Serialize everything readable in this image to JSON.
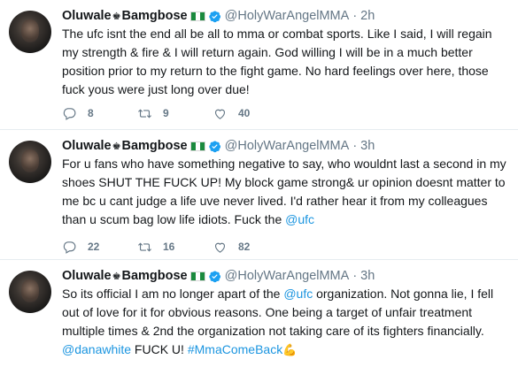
{
  "tweets": [
    {
      "name": "Oluwale",
      "crown": "♚",
      "name2": "Bamgbose",
      "handle": "@HolyWarAngelMMA",
      "separator": "·",
      "time": "2h",
      "text": "The ufc isnt the end all be all to mma or combat sports. Like I said, I will regain my strength & fire & I will return again. God willing I will be in a much better position prior to my return to the fight game. No hard feelings over here, those fuck yous were just long over due!",
      "replies": "8",
      "retweets": "9",
      "likes": "40"
    },
    {
      "name": "Oluwale",
      "crown": "♚",
      "name2": "Bamgbose",
      "handle": "@HolyWarAngelMMA",
      "separator": "·",
      "time": "3h",
      "text_main": "For u fans who have something negative to say, who wouldnt last a second in my shoes SHUT THE FUCK UP! My block game strong& ur opinion doesnt matter to me bc u cant judge a life uve never lived. I'd rather hear it from my colleagues than u scum bag low life idiots. Fuck the ",
      "mention": "@ufc",
      "replies": "22",
      "retweets": "16",
      "likes": "82"
    },
    {
      "name": "Oluwale",
      "crown": "♚",
      "name2": "Bamgbose",
      "handle": "@HolyWarAngelMMA",
      "separator": "·",
      "time": "3h",
      "text_a": "So its official I am no longer apart of the ",
      "mention_a": "@ufc",
      "text_b": " organization. Not gonna lie, I fell out of love for it for obvious reasons. One being a target of unfair treatment multiple times & 2nd the organization not taking care of its fighters financially. ",
      "mention_b": "@danawhite",
      "text_c": " FUCK U! ",
      "hashtag": "#MmaComeBack",
      "emoji": "💪"
    }
  ],
  "colors": {
    "link": "#1b95e0",
    "muted": "#657786",
    "divider": "#e6ecf0",
    "flag_green": "#1b8a3e"
  }
}
